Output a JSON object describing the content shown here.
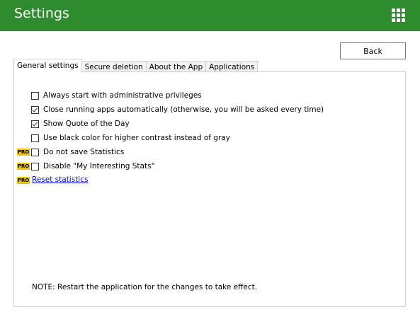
{
  "window": {
    "title": "Settings"
  },
  "toolbar": {
    "back_label": "Back"
  },
  "tabs": [
    {
      "label": "General settings",
      "active": true
    },
    {
      "label": "Secure deletion",
      "active": false
    },
    {
      "label": "About the App",
      "active": false
    },
    {
      "label": "Applications",
      "active": false
    }
  ],
  "options": [
    {
      "label": "Always start with administrative privileges",
      "checked": false
    },
    {
      "label": "Close running apps automatically (otherwise, you will be asked every time)",
      "checked": true
    },
    {
      "label": "Show Quote of the Day",
      "checked": true
    },
    {
      "label": "Use black color for higher contrast instead of gray",
      "checked": false
    }
  ],
  "pro_options": [
    {
      "badge": "PRO",
      "label": "Do not save Statistics",
      "checked": false
    },
    {
      "badge": "PRO",
      "label": "Disable \"My Interesting Stats\"",
      "checked": false
    }
  ],
  "reset": {
    "badge": "PRO",
    "label": "Reset statistics"
  },
  "note": "NOTE: Restart the application for the changes to take effect.",
  "colors": {
    "header": "#2e8b2e",
    "pro_badge": "#f2c300",
    "link": "#0000ee"
  }
}
